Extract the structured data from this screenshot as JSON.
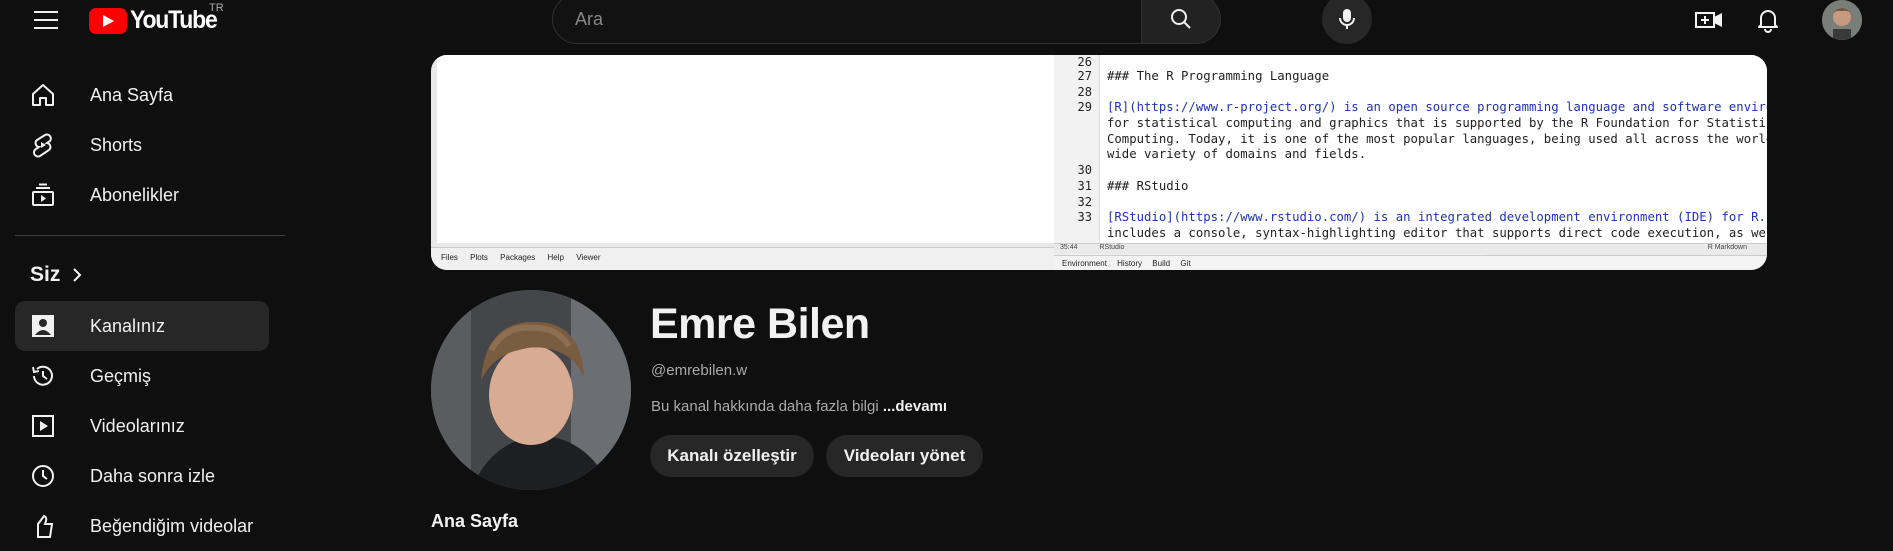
{
  "app": {
    "logo_text": "YouTube",
    "country": "TR"
  },
  "search": {
    "placeholder": "Ara"
  },
  "sidebar": {
    "items": [
      {
        "label": "Ana Sayfa",
        "icon": "home-icon"
      },
      {
        "label": "Shorts",
        "icon": "shorts-icon"
      },
      {
        "label": "Abonelikler",
        "icon": "subscriptions-icon"
      }
    ],
    "section_title": "Siz",
    "you_items": [
      {
        "label": "Kanalınız",
        "icon": "your-channel-icon",
        "active": true
      },
      {
        "label": "Geçmiş",
        "icon": "history-icon"
      },
      {
        "label": "Videolarınız",
        "icon": "your-videos-icon"
      },
      {
        "label": "Daha sonra izle",
        "icon": "watch-later-icon"
      },
      {
        "label": "Beğendiğim videolar",
        "icon": "liked-videos-icon"
      }
    ]
  },
  "banner": {
    "pane_tabs": [
      "Files",
      "Plots",
      "Packages",
      "Help",
      "Viewer"
    ],
    "env_tabs": [
      "Environment",
      "History",
      "Build",
      "Git"
    ],
    "editor": {
      "line_numbers": [
        "26",
        "27",
        "28",
        "29",
        "30",
        "31",
        "32",
        "33"
      ],
      "lines": [
        "### The R Programming Language",
        "[R](https://www.r-project.org/) is an open source programming language and software environment",
        "for statistical computing and graphics that is supported by the R Foundation for Statistical",
        "Computing. Today, it is one of the most popular languages, being used all across the world in a",
        "wide variety of domains and fields.",
        "### RStudio",
        "[RStudio](https://www.rstudio.com/) is an integrated development environment (IDE) for R. It",
        "includes a console, syntax-highlighting editor that supports direct code execution, as well as"
      ],
      "status_pos": "35:44",
      "status_scope": "RStudio",
      "status_mode": "R Markdown"
    }
  },
  "channel": {
    "name": "Emre Bilen",
    "handle": "@emrebilen.w",
    "description": "Bu kanal hakkında daha fazla bilgi",
    "more": "...devamı",
    "customize_label": "Kanalı özelleştir",
    "manage_label": "Videoları yönet",
    "tab_peek": "Ana Sayfa"
  }
}
